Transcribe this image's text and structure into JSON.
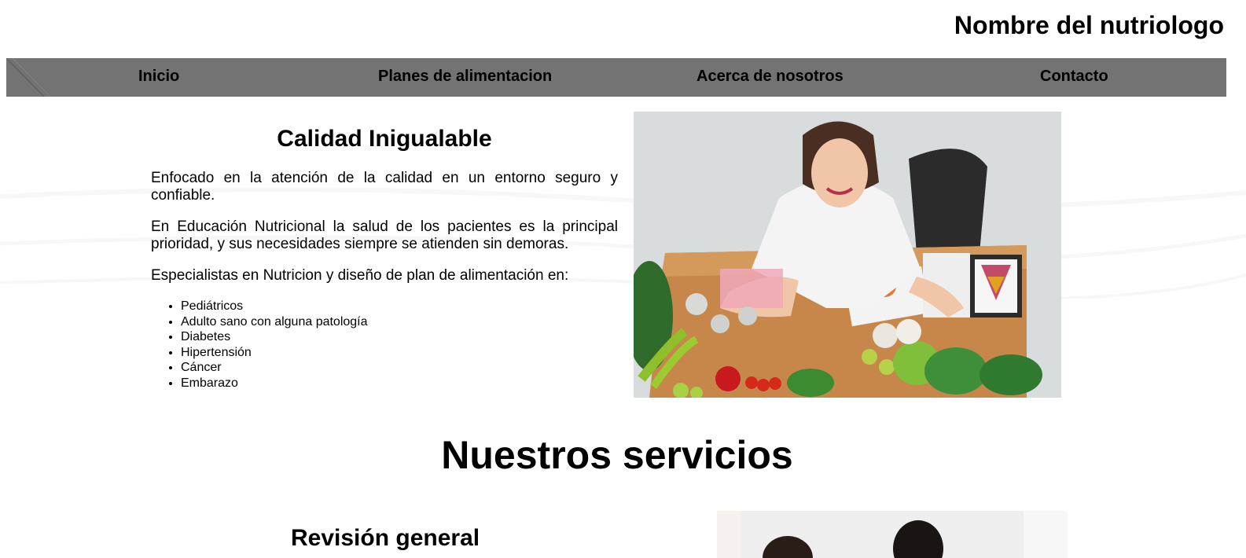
{
  "header": {
    "title": "Nombre del nutriologo"
  },
  "nav": {
    "items": [
      {
        "label": "Inicio"
      },
      {
        "label": "Planes de alimentacion"
      },
      {
        "label": "Acerca de nosotros"
      },
      {
        "label": "Contacto"
      }
    ]
  },
  "intro": {
    "heading": "Calidad Inigualable",
    "paragraphs": [
      "Enfocado en la atención de la calidad en un entorno seguro y confiable.",
      "En Educación Nutricional la salud de los pacientes es la principal prioridad, y sus necesidades siempre se atienden sin demoras.",
      "Especialistas en Nutricion y diseño de plan de alimentación en:"
    ],
    "specialties": [
      "Pediátricos",
      "Adulto sano con alguna patología",
      "Diabetes",
      "Hipertensión",
      "Cáncer",
      "Embarazo"
    ]
  },
  "services": {
    "title": "Nuestros servicios",
    "first_heading": "Revisión general"
  },
  "colors": {
    "nav_bg": "#737373",
    "background": "#ffffff",
    "text": "#000000"
  }
}
